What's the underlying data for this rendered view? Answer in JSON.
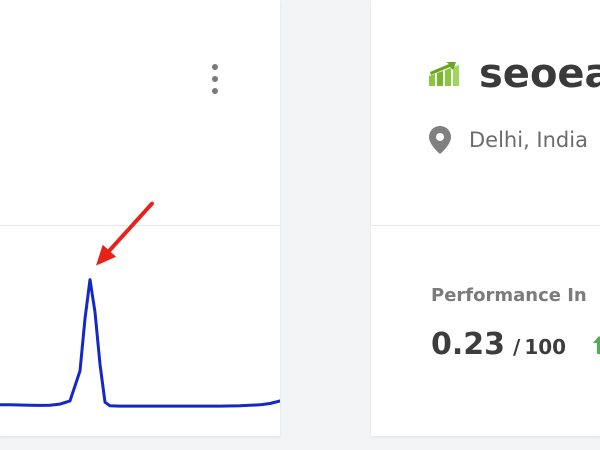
{
  "left_card": {
    "menu_icon": "kebab-vertical-icon",
    "chart_data": {
      "type": "line",
      "title": "",
      "xlabel": "",
      "ylabel": "",
      "x": [
        0,
        10,
        20,
        30,
        40,
        50,
        60,
        70,
        80,
        85,
        90,
        95,
        100,
        105,
        110,
        120,
        140,
        160,
        180,
        200,
        220,
        240,
        260,
        270,
        280
      ],
      "values": [
        4,
        4,
        3.8,
        3.6,
        3.5,
        3.6,
        4.5,
        7,
        30,
        70,
        100,
        75,
        35,
        6,
        3.2,
        3.0,
        3.0,
        3.0,
        3.0,
        3.0,
        3.0,
        3.2,
        4,
        5,
        7
      ],
      "ylim": [
        0,
        115
      ],
      "grid": false,
      "series_color": "#1428c8",
      "annotation": {
        "type": "arrow",
        "points_to_x": 90,
        "color": "#e8221b"
      }
    }
  },
  "right_card": {
    "brand": {
      "name": "seoea",
      "icon": "seo-bars-logo-icon",
      "accent": "#8cc63f"
    },
    "location": {
      "icon": "map-pin-icon",
      "text": "Delhi, India"
    },
    "performance": {
      "label": "Performance In",
      "score": "0.23",
      "separator": "/",
      "max": "100",
      "trend_icon": "trend-up-arrow-icon",
      "trend_color": "#4caf50"
    }
  }
}
